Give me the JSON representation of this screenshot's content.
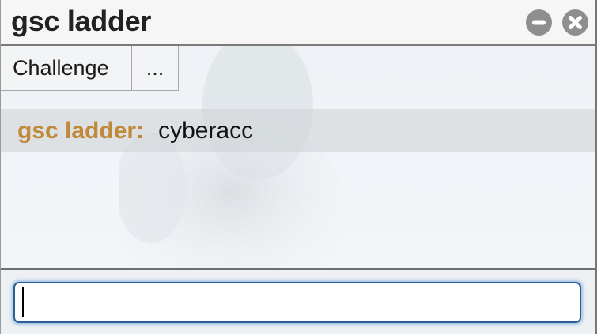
{
  "window": {
    "title": "gsc ladder",
    "controls": [
      {
        "name": "minimize",
        "icon": "minus-circle-icon"
      },
      {
        "name": "close",
        "icon": "x-circle-icon"
      }
    ]
  },
  "tabs": [
    {
      "label": "Challenge"
    },
    {
      "label": "..."
    }
  ],
  "chat": {
    "messages": [
      {
        "user": "gsc ladder:",
        "text": "cyberacc"
      }
    ]
  },
  "input": {
    "value": "",
    "placeholder": ""
  },
  "colors": {
    "username": "#c0893a",
    "input_border": "#2c5f95",
    "control_button": "#8e8e8e"
  }
}
